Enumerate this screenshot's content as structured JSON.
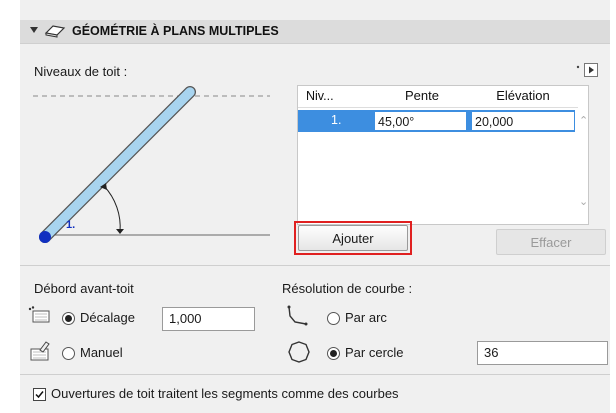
{
  "header": {
    "title": "GÉOMÉTRIE À PLANS MULTIPLES"
  },
  "roof_levels": {
    "label": "Niveaux de toit :",
    "diagram_number": "1.",
    "table": {
      "columns": [
        "Niv...",
        "Pente",
        "Elévation"
      ],
      "rows": [
        {
          "level": "1.",
          "slope": "45,00°",
          "elevation": "20,000"
        }
      ]
    },
    "add_button": "Ajouter",
    "delete_button": "Effacer"
  },
  "overhang": {
    "title": "Débord avant-toit",
    "offset_label": "Décalage",
    "offset_value": "1,000",
    "manual_label": "Manuel",
    "selected": "offset"
  },
  "curve_resolution": {
    "title": "Résolution de courbe :",
    "by_arc_label": "Par arc",
    "by_circle_label": "Par cercle",
    "circle_value": "36",
    "selected": "circle"
  },
  "roof_openings": {
    "label": "Ouvertures de toit traitent les segments comme des courbes",
    "checked": true
  },
  "colors": {
    "selection": "#3d8ee0",
    "highlight": "#e02020",
    "diagram_fill": "#a8d4ef",
    "level_mark": "#1030c0"
  }
}
